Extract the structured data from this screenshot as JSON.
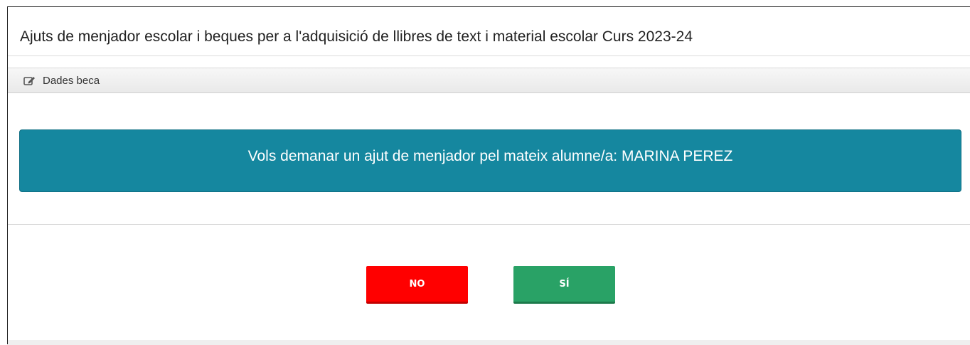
{
  "page": {
    "title": "Ajuts de menjador escolar i beques per a l'adquisició de llibres de text i material escolar Curs 2023-24"
  },
  "section": {
    "icon": "edit-icon",
    "label": "Dades beca"
  },
  "alert": {
    "message": "Vols demanar un ajut de menjador pel mateix alumne/a: MARINA PEREZ"
  },
  "buttons": {
    "no_label": "NO",
    "yes_label": "SÍ"
  },
  "colors": {
    "alert_bg": "#15879f",
    "no_button": "#ff0000",
    "yes_button": "#29a266"
  }
}
